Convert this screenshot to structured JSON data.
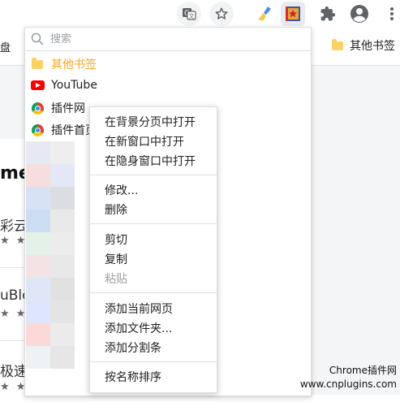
{
  "toolbar": {
    "icons": [
      "translate-icon",
      "star-icon",
      "broom-extension-icon",
      "bookmark-extension-icon",
      "extensions-puzzle-icon",
      "profile-avatar-icon",
      "more-menu-icon"
    ]
  },
  "bookmarks_bar": {
    "left_fragment": "盘",
    "folder_label": "其他书签"
  },
  "page_behind": {
    "title_fragment": "me",
    "items": [
      "彩云",
      "uBlo",
      "极速"
    ],
    "stars": "★ ★"
  },
  "dropdown": {
    "search_placeholder": "搜索",
    "items": [
      {
        "label": "其他书签",
        "icon": "folder-icon",
        "color": "#f5a623"
      },
      {
        "label": "YouTube",
        "icon": "youtube-icon"
      },
      {
        "label": "插件网",
        "icon": "chrome-icon"
      },
      {
        "label": "插件首页",
        "icon": "chrome-icon"
      }
    ]
  },
  "context_menu": {
    "groups": [
      [
        "在背景分页中打开",
        "在新窗口中打开",
        "在隐身窗口中打开"
      ],
      [
        "修改...",
        "删除"
      ],
      [
        "剪切",
        "复制",
        "粘贴"
      ],
      [
        "添加当前网页",
        "添加文件夹...",
        "添加分割条"
      ],
      [
        "按名称排序"
      ]
    ],
    "disabled": [
      "粘贴"
    ]
  },
  "watermark": {
    "line1": "Chrome插件网",
    "line2": "www.cnplugins.com"
  },
  "colors": {
    "accent_active": "#e8eaed",
    "folder_yellow": "#fcd267",
    "youtube_red": "#ff0000",
    "disabled_text": "#a0a0a0"
  }
}
